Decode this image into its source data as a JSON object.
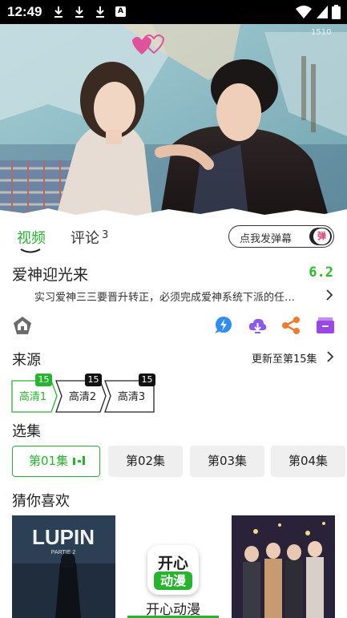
{
  "status_bar": {
    "time": "12:49",
    "keyboard_badge": "A"
  },
  "player": {
    "overlay_mark": "1510"
  },
  "tabs": {
    "video_label": "视频",
    "comments_label": "评论",
    "comments_count": "3"
  },
  "danmaku": {
    "label": "点我发弹幕",
    "toggle_glyph": "弹"
  },
  "show": {
    "title": "爱神迎光来",
    "rating": "6.2",
    "synopsis": "实习爱神三三要晋升转正，必须完成爱神系统下派的任…"
  },
  "source": {
    "section_title": "来源",
    "update_text": "更新至第15集",
    "options": [
      {
        "label": "高清1",
        "count": "15",
        "selected": true
      },
      {
        "label": "高清2",
        "count": "15",
        "selected": false
      },
      {
        "label": "高清3",
        "count": "15",
        "selected": false
      }
    ]
  },
  "episodes": {
    "section_title": "选集",
    "items": [
      "第01集",
      "第02集",
      "第03集",
      "第04集"
    ]
  },
  "recommend": {
    "section_title": "猜你喜欢",
    "poster_1": {
      "title": "LUPIN",
      "subtitle": "PARTIE 2"
    },
    "app_logo_top": "开心",
    "app_logo_bottom": "动漫",
    "app_name": "开心动漫"
  },
  "colors": {
    "accent": "#27b52f",
    "rating": "#2bbd2a",
    "badge_dark": "#111111"
  },
  "icons": [
    "download-icon",
    "keyboard-icon",
    "wifi-icon",
    "battery-icon",
    "home-icon",
    "chat-bolt-icon",
    "cloud-download-icon",
    "share-icon",
    "folder-icon",
    "chevron-right-icon",
    "play-bars-icon"
  ]
}
